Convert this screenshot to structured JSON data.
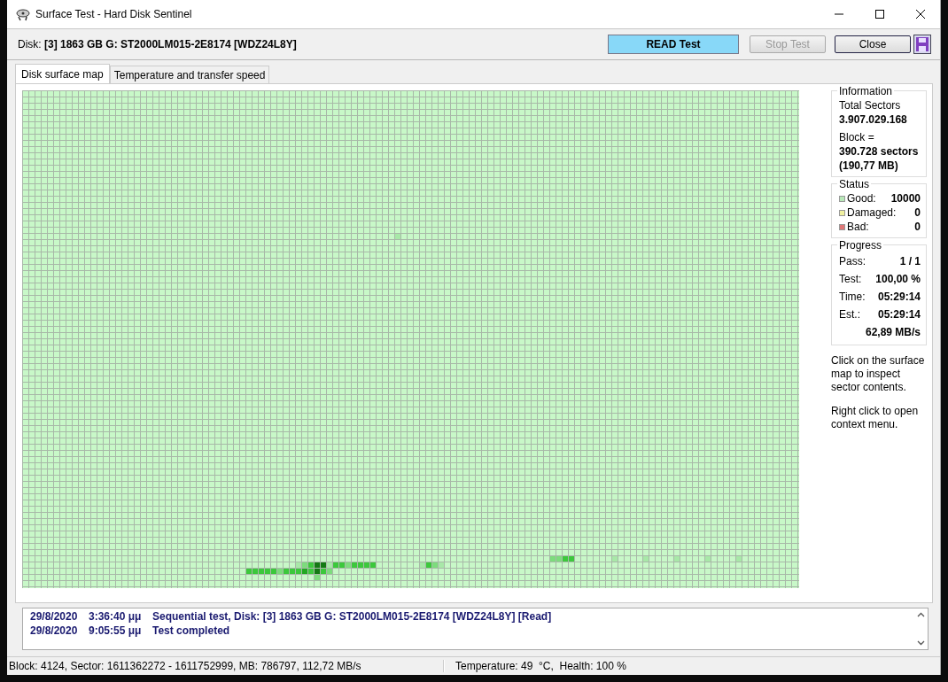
{
  "window": {
    "title": "Surface Test - Hard Disk Sentinel"
  },
  "disk": {
    "label": "Disk:",
    "value": "[3] 1863 GB G: ST2000LM015-2E8174 [WDZ24L8Y]"
  },
  "mode_indicator": "READ Test",
  "buttons": [
    {
      "label": "Stop Test",
      "disabled": true
    },
    {
      "label": "Close",
      "disabled": false
    }
  ],
  "tabs": [
    {
      "label": "Disk surface map",
      "selected": true
    },
    {
      "label": "Temperature and transfer speed",
      "selected": false
    }
  ],
  "information": {
    "title": "Information",
    "total_label": "Total Sectors",
    "total_value": "3.907.029.168",
    "block_label": "Block =",
    "block_sectors": "390.728 sectors",
    "block_size": "(190,77 MB)"
  },
  "status": {
    "title": "Status",
    "items": [
      {
        "label": "Good:",
        "value": "10000",
        "color": "#b8e8b8"
      },
      {
        "label": "Damaged:",
        "value": "0",
        "color": "#f0f0a0"
      },
      {
        "label": "Bad:",
        "value": "0",
        "color": "#e07878"
      }
    ]
  },
  "progress": {
    "title": "Progress",
    "rows": [
      {
        "label": "Pass:",
        "value": "1 / 1"
      },
      {
        "label": "Test:",
        "value": "100,00 %"
      },
      {
        "label": "Time:",
        "value": "05:29:14"
      },
      {
        "label": "Est.:",
        "value": "05:29:14"
      }
    ],
    "speed": "62,89 MB/s"
  },
  "hints": [
    "Click on the surface map to inspect sector contents.",
    "Right click to open context menu."
  ],
  "log": [
    {
      "date": "29/8/2020",
      "time": "3:36:40 μμ",
      "message": "Sequential test, Disk: [3] 1863 GB G: ST2000LM015-2E8174 [WDZ24L8Y] [Read]"
    },
    {
      "date": "29/8/2020",
      "time": "9:05:55 μμ",
      "message": "Test completed"
    }
  ],
  "status_bar": {
    "left": "Block: 4124, Sector: 1611362272 - 1611752999, MB: 786797, 112,72 MB/s",
    "right": "Temperature: 49  °C,  Health: 100 %"
  }
}
